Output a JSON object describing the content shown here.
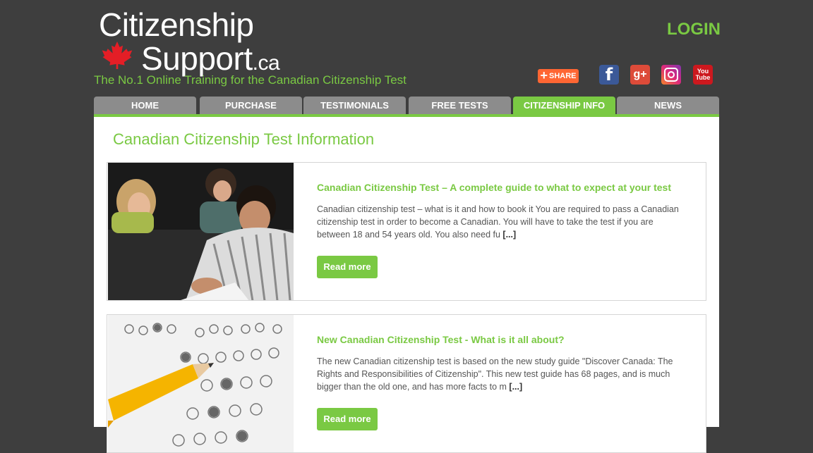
{
  "header": {
    "logo_line1": "Citizenship",
    "logo_line2": "Support",
    "logo_suffix": ".ca",
    "tagline": "The No.1 Online Training for the Canadian Citizenship Test",
    "login_label": "LOGIN",
    "share_label": "SHARE",
    "social": [
      "facebook-icon",
      "google-plus-icon",
      "instagram-icon",
      "youtube-icon"
    ]
  },
  "nav": {
    "items": [
      {
        "label": "HOME"
      },
      {
        "label": "PURCHASE"
      },
      {
        "label": "TESTIMONIALS"
      },
      {
        "label": "FREE TESTS"
      },
      {
        "label": "CITIZENSHIP INFO"
      },
      {
        "label": "NEWS"
      }
    ],
    "active_index": 4
  },
  "main": {
    "title": "Canadian Citizenship Test Information",
    "articles": [
      {
        "title": "Canadian Citizenship Test – A complete guide to what to expect at your test",
        "excerpt": "Canadian citizenship test – what is it and how to book it You are required to pass a Canadian citizenship test in order to become a Canadian. You will have to take the test if you are between 18 and 54 years old. You also need fu",
        "more": "[...]",
        "button": "Read more"
      },
      {
        "title": "New Canadian Citizenship Test - What is it all about?",
        "excerpt": "The new Canadian citizenship test is based on the new study guide \"Discover Canada: The Rights and Responsibilities of Citizenship\". This new test guide has 68 pages, and is much bigger than the old one, and has more facts to m",
        "more": "[...]",
        "button": "Read more"
      }
    ]
  },
  "colors": {
    "background": "#3e3e3e",
    "accent": "#7ac943",
    "nav_inactive": "#8c8c8c",
    "share": "#ff6633"
  }
}
